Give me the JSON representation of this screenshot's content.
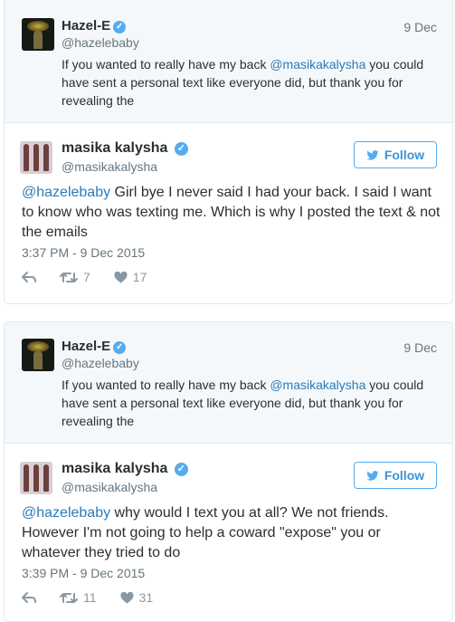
{
  "tweets": [
    {
      "quoted": {
        "name": "Hazel-E",
        "handle": "@hazelebaby",
        "date": "9 Dec",
        "text_before": "If you wanted to really have my back ",
        "mention": "@masikakalysha",
        "text_after": " you could have sent a personal text like everyone did, but thank you for revealing the"
      },
      "main": {
        "name": "masika kalysha",
        "handle": "@masikakalysha",
        "follow_label": "Follow",
        "mention": "@hazelebaby",
        "text": " Girl bye I never said I had your back. I said I want to know who was texting me. Which is why I posted the text & not the emails",
        "timestamp": "3:37 PM - 9 Dec 2015",
        "retweets": "7",
        "likes": "17"
      }
    },
    {
      "quoted": {
        "name": "Hazel-E",
        "handle": "@hazelebaby",
        "date": "9 Dec",
        "text_before": "If you wanted to really have my back ",
        "mention": "@masikakalysha",
        "text_after": " you could have sent a personal text like everyone did, but thank you for revealing the"
      },
      "main": {
        "name": "masika kalysha",
        "handle": "@masikakalysha",
        "follow_label": "Follow",
        "mention": "@hazelebaby",
        "text": " why would I text you at all? We not friends. However I'm not going to help a coward \"expose\" you or whatever they tried to do",
        "timestamp": "3:39 PM - 9 Dec 2015",
        "retweets": "11",
        "likes": "31"
      }
    }
  ],
  "icons": {
    "verified": "verified-badge-icon",
    "reply": "reply-icon",
    "retweet": "retweet-icon",
    "like": "heart-icon",
    "follow": "twitter-bird-icon"
  },
  "colors": {
    "link": "#2b7bb9",
    "follow_border": "#55acee",
    "muted": "#66757f",
    "quoted_bg": "#f5f8fa"
  }
}
